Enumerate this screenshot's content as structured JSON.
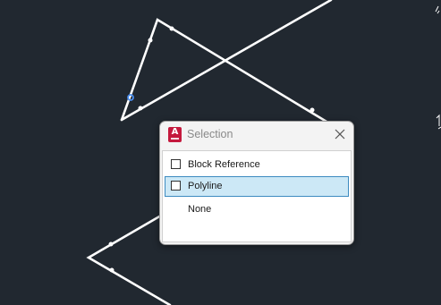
{
  "dialog": {
    "title": "Selection",
    "app_icon": {
      "name": "autocad-app-icon",
      "letter": "A",
      "color": "#c4193d"
    },
    "close_icon": "close-icon",
    "options": [
      {
        "label": "Block Reference",
        "checkbox": true,
        "checked": false,
        "selected": false
      },
      {
        "label": "Polyline",
        "checkbox": true,
        "checked": false,
        "selected": true
      },
      {
        "label": "None",
        "checkbox": false,
        "selected": false
      }
    ]
  },
  "canvas": {
    "background": "#212830",
    "line_color": "#ffffff",
    "grip_color": "#4a8ef0"
  }
}
